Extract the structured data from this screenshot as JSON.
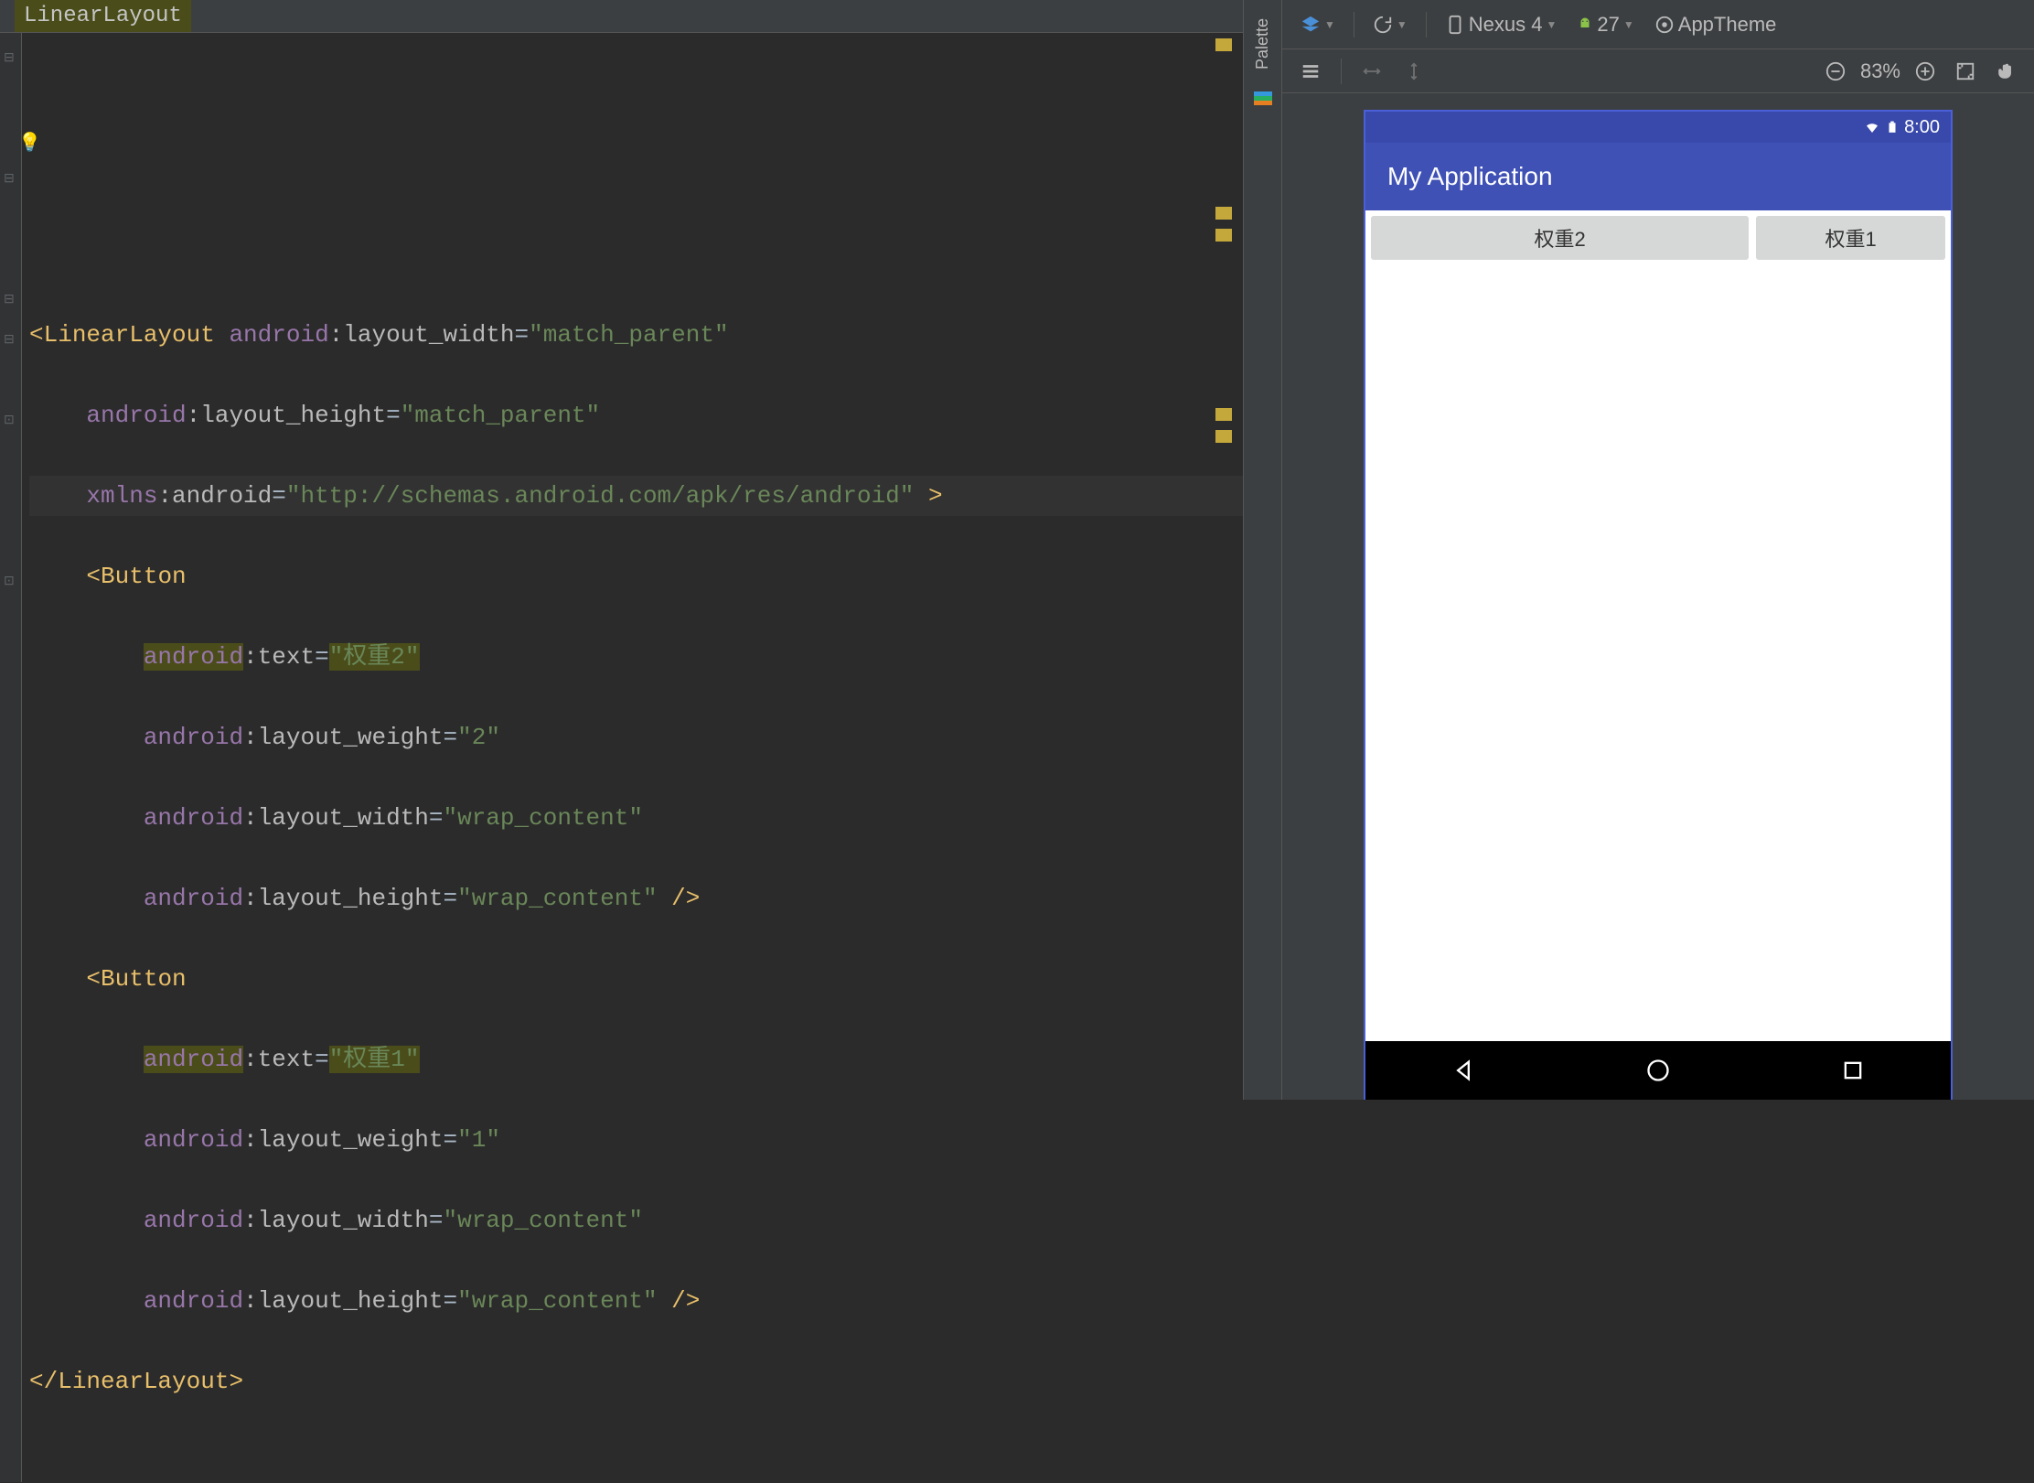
{
  "breadcrumb": "LinearLayout",
  "code": {
    "root_tag": "LinearLayout",
    "root_attrs": {
      "layout_width": {
        "ns": "android",
        "name": "layout_width",
        "value": "\"match_parent\""
      },
      "layout_height": {
        "ns": "android",
        "name": "layout_height",
        "value": "\"match_parent\""
      },
      "xmlns": {
        "ns": "xmlns",
        "name": "android",
        "value": "\"http://schemas.android.com/apk/res/android\""
      }
    },
    "btn1_tag": "Button",
    "btn1": {
      "text": {
        "ns": "android",
        "name": "text",
        "value": "\"权重2\""
      },
      "weight": {
        "ns": "android",
        "name": "layout_weight",
        "value": "\"2\""
      },
      "width": {
        "ns": "android",
        "name": "layout_width",
        "value": "\"wrap_content\""
      },
      "height": {
        "ns": "android",
        "name": "layout_height",
        "value": "\"wrap_content\""
      }
    },
    "btn2_tag": "Button",
    "btn2": {
      "text": {
        "ns": "android",
        "name": "text",
        "value": "\"权重1\""
      },
      "weight": {
        "ns": "android",
        "name": "layout_weight",
        "value": "\"1\""
      },
      "width": {
        "ns": "android",
        "name": "layout_width",
        "value": "\"wrap_content\""
      },
      "height": {
        "ns": "android",
        "name": "layout_height",
        "value": "\"wrap_content\""
      }
    },
    "close_tag": "LinearLayout"
  },
  "preview_toolbar": {
    "device": "Nexus 4",
    "api": "27",
    "theme": "AppTheme",
    "zoom": "83%"
  },
  "device": {
    "time": "8:00",
    "app_title": "My Application",
    "button1": "权重2",
    "button2": "权重1"
  }
}
